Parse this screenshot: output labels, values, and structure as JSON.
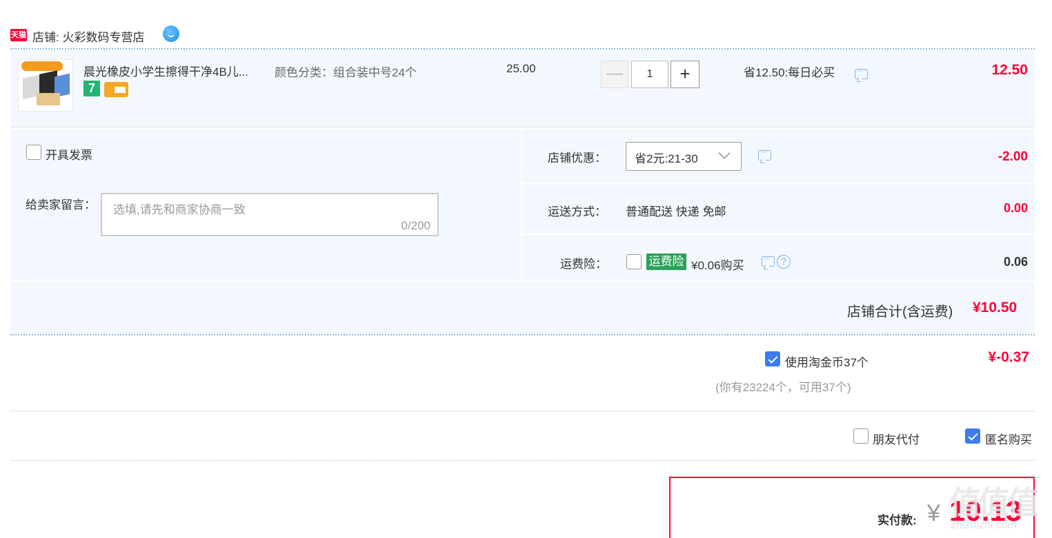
{
  "shop": {
    "platform_badge": "天猫",
    "label": "店铺: 火彩数码专营店"
  },
  "item": {
    "title": "晨光橡皮小学生擦得干净4B儿...",
    "service_badge": "7",
    "sku": "颜色分类：组合装中号24个",
    "unit_price": "25.00",
    "quantity": "1",
    "qty_minus": "—",
    "qty_plus": "+",
    "promo": "省12.50:每日必买",
    "subtotal": "12.50"
  },
  "invoice": {
    "label": "开具发票",
    "checked": false
  },
  "message": {
    "label": "给卖家留言：",
    "placeholder": "选填,请先和商家协商一致",
    "counter": "0/200"
  },
  "shop_discount": {
    "label": "店铺优惠：",
    "selected": "省2元:21-30",
    "value": "-2.00"
  },
  "shipping": {
    "label": "运送方式：",
    "method": "普通配送 快递 免邮",
    "value": "0.00"
  },
  "insurance": {
    "label": "运费险：",
    "tag": "运费险",
    "price_text": "¥0.06购买",
    "help": "?",
    "value": "0.06"
  },
  "shop_total": {
    "label": "店铺合计(含运费)",
    "value": "¥10.50"
  },
  "coins": {
    "label": "使用淘金币37个",
    "value": "¥-0.37",
    "note": "(你有23224个，可用37个)",
    "checked": true
  },
  "options": {
    "friend_pay": "朋友代付",
    "anonymous": "匿名购买"
  },
  "final": {
    "label": "实付款:",
    "currency": "¥",
    "amount": "10.13"
  },
  "watermark": {
    "main": "值值值",
    "sub": "zhizhizhi.com"
  },
  "colors": {
    "accent_red": "#ff0036",
    "panel_bg": "#f3f8fe",
    "checkbox_blue": "#3d7cf0",
    "insurance_green": "#2aa15a"
  }
}
